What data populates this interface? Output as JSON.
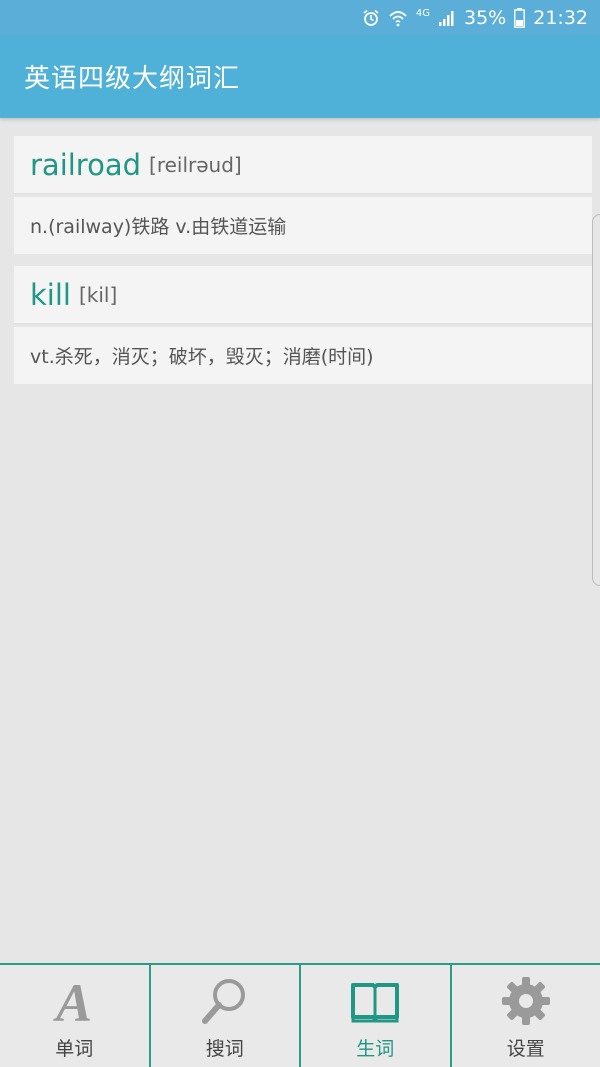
{
  "status": {
    "battery": "35%",
    "time": "21:32",
    "network": "4G"
  },
  "app": {
    "title": "英语四级大纲词汇"
  },
  "words": [
    {
      "word": "railroad",
      "phonetic": "[reilrəud]",
      "definition": "n.(railway)铁路 v.由铁道运输"
    },
    {
      "word": "kill",
      "phonetic": "[kil]",
      "definition": "vt.杀死，消灭；破坏，毁灭；消磨(时间)"
    }
  ],
  "tabs": [
    {
      "label": "单词",
      "icon": "letter-a-icon",
      "active": false
    },
    {
      "label": "搜词",
      "icon": "search-icon",
      "active": false
    },
    {
      "label": "生词",
      "icon": "book-icon",
      "active": true
    },
    {
      "label": "设置",
      "icon": "gear-icon",
      "active": false
    }
  ],
  "colors": {
    "appbar": "#4fb0d8",
    "accent": "#1f9784"
  }
}
